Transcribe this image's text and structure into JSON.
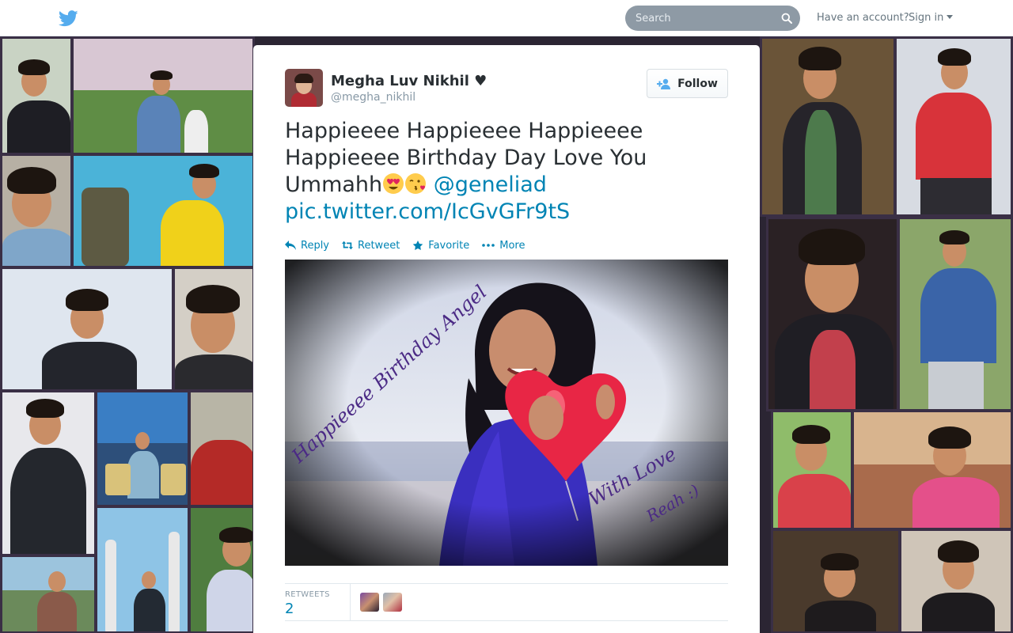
{
  "header": {
    "search_placeholder": "Search",
    "have_account": "Have an account?",
    "sign_in": "Sign in"
  },
  "tweet": {
    "fullname": "Megha Luv Nikhil ♥",
    "username": "@megha_nikhil",
    "follow_label": "Follow",
    "text": "Happieeee Happieeee Happieeee Happieeee Birthday Day Love You Ummahh",
    "mention": "@geneliad",
    "pic_link": "pic.twitter.com/IcGvGFr9tS",
    "actions": {
      "reply": "Reply",
      "retweet": "Retweet",
      "favorite": "Favorite",
      "more": "More"
    },
    "stats": {
      "retweets_label": "RETWEETS",
      "retweets_count": "2"
    }
  },
  "image_text": {
    "line1": "Happieeee Birthday Angel",
    "line2": "With Love",
    "line3": "Reah :)"
  },
  "colors": {
    "link": "#0084b4",
    "brand": "#55acee",
    "text": "#292f33",
    "muted": "#8899a6"
  }
}
